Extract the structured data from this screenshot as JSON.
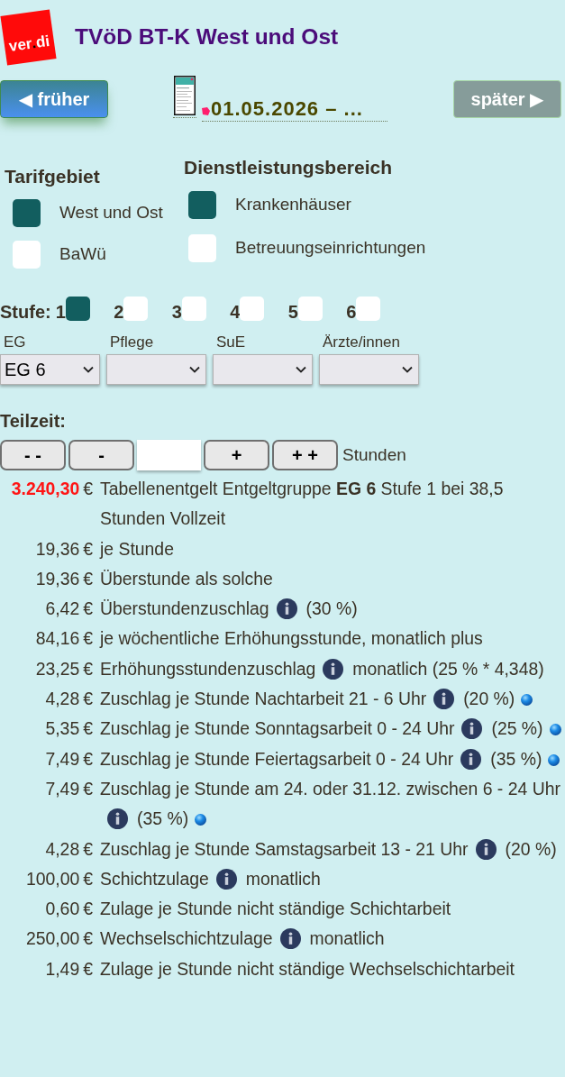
{
  "header": {
    "logo": {
      "parts": [
        "ver",
        ".",
        "di"
      ]
    },
    "title": "TVöD BT-K West und Ost"
  },
  "navigation": {
    "previous": {
      "label": "◀ früher",
      "disabled": false
    },
    "period": {
      "label": "01.05.2026 – ..."
    },
    "next": {
      "label": "später ▶",
      "disabled": true
    }
  },
  "tarifgebiet": {
    "title": "Tarifgebiet",
    "options": [
      {
        "label": "West und Ost",
        "selected": true
      },
      {
        "label": "BaWü",
        "selected": false
      }
    ]
  },
  "dienstleistungsbereich": {
    "title": "Dienstleistungsbereich",
    "options": [
      {
        "label": "Krankenhäuser",
        "selected": true
      },
      {
        "label": "Betreuungseinrichtungen",
        "selected": false
      }
    ]
  },
  "stufe": {
    "label": "Stufe:",
    "options": [
      {
        "label": "1",
        "selected": true
      },
      {
        "label": "2",
        "selected": false
      },
      {
        "label": "3",
        "selected": false
      },
      {
        "label": "4",
        "selected": false
      },
      {
        "label": "5",
        "selected": false
      },
      {
        "label": "6",
        "selected": false
      }
    ]
  },
  "groups": [
    {
      "label": "EG",
      "value": "EG 6"
    },
    {
      "label": "Pflege"
    },
    {
      "label": "SuE"
    },
    {
      "label": "Ärzte/innen"
    }
  ],
  "teilzeit": {
    "title": "Teilzeit:",
    "buttons_before": [
      "- -",
      "-"
    ],
    "buttons_after": [
      "+",
      "+ +"
    ],
    "unit": "Stunden"
  },
  "rows": [
    {
      "amount": "3.240,30",
      "currency": "€",
      "emphasis": true,
      "label": "Tabellenentgelt Entgeltgruppe **EG 6** Stufe 1 bei 38,5 Stunden Vollzeit",
      "info": false,
      "marker": false
    },
    {
      "amount": "19,36",
      "currency": "€",
      "emphasis": false,
      "label": "je Stunde",
      "info": false,
      "marker": false
    },
    {
      "amount": "19,36",
      "currency": "€",
      "emphasis": false,
      "label": "Überstunde als solche",
      "info": false,
      "marker": false
    },
    {
      "amount": "6,42",
      "currency": "€",
      "emphasis": false,
      "label": "Überstundenzuschlag",
      "info": true,
      "note": "(30 %)",
      "marker": false
    },
    {
      "amount": "84,16",
      "currency": "€",
      "emphasis": false,
      "label": "je wöchentliche Erhöhungsstunde, monatlich plus",
      "info": false,
      "marker": false
    },
    {
      "amount": "23,25",
      "currency": "€",
      "emphasis": false,
      "label": "Erhöhungsstundenzuschlag",
      "info": true,
      "note": "monatlich (25 % * 4,348)",
      "marker": false
    },
    {
      "amount": "4,28",
      "currency": "€",
      "emphasis": false,
      "label": "Zuschlag je Stunde Nachtarbeit 21 - 6 Uhr",
      "info": true,
      "note": "(20 %)",
      "marker": true
    },
    {
      "amount": "5,35",
      "currency": "€",
      "emphasis": false,
      "label": "Zuschlag je Stunde Sonntagsarbeit 0 - 24 Uhr",
      "info": true,
      "note": "(25 %)",
      "marker": true
    },
    {
      "amount": "7,49",
      "currency": "€",
      "emphasis": false,
      "label": "Zuschlag je Stunde Feiertagsarbeit 0 - 24 Uhr",
      "info": true,
      "note": "(35 %)",
      "marker": true
    },
    {
      "amount": "7,49",
      "currency": "€",
      "emphasis": false,
      "label": "Zuschlag je Stunde am 24. oder 31.12. zwischen 6 - 24 Uhr",
      "info": true,
      "note": "(35 %)",
      "marker": true
    },
    {
      "amount": "4,28",
      "currency": "€",
      "emphasis": false,
      "label": "Zuschlag je Stunde Samstagsarbeit 13 - 21 Uhr",
      "info": true,
      "note": "(20 %)",
      "marker": false
    },
    {
      "amount": "100,00",
      "currency": "€",
      "emphasis": false,
      "label": "Schichtzulage",
      "info": true,
      "note": "monatlich",
      "marker": false
    },
    {
      "amount": "0,60",
      "currency": "€",
      "emphasis": false,
      "label": "Zulage je Stunde nicht ständige Schichtarbeit",
      "info": false,
      "marker": false
    },
    {
      "amount": "250,00",
      "currency": "€",
      "emphasis": false,
      "label": "Wechselschichtzulage",
      "info": true,
      "note": "monatlich",
      "marker": false
    },
    {
      "amount": "1,49",
      "currency": "€",
      "emphasis": false,
      "label": "Zulage je Stunde nicht ständige Wechselschichtarbeit",
      "info": false,
      "marker": false
    }
  ]
}
